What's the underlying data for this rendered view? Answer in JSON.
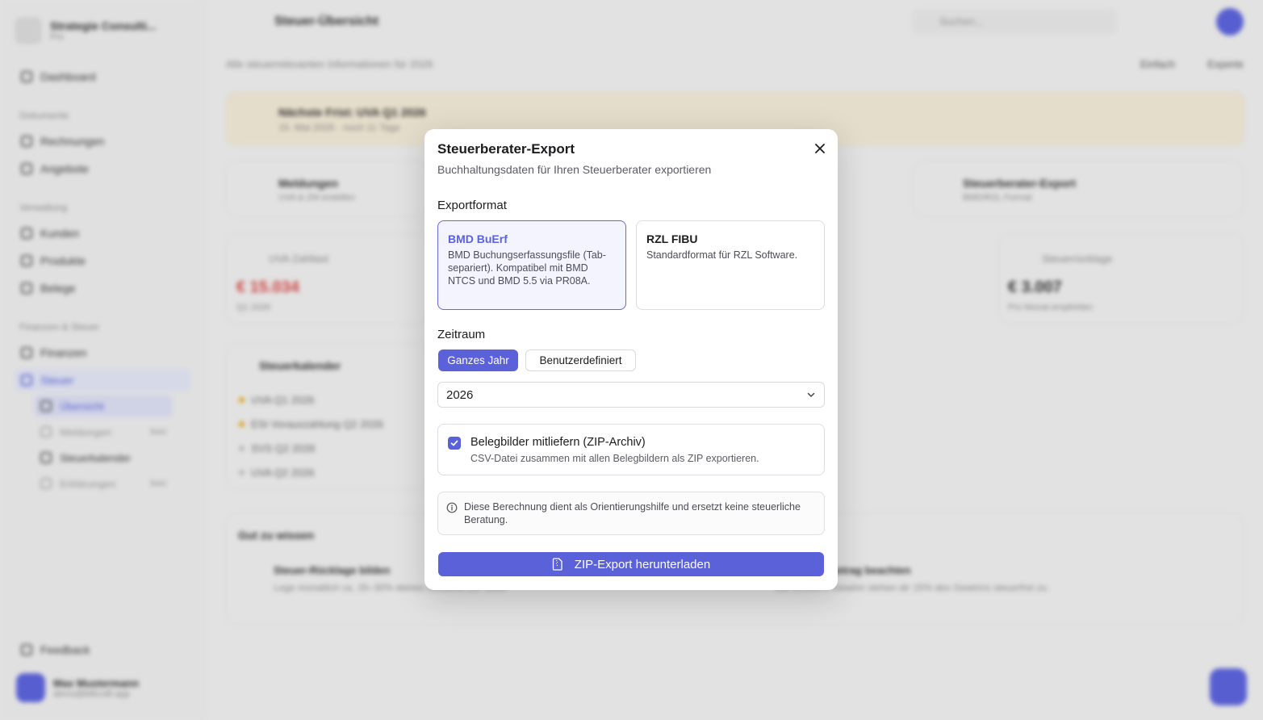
{
  "background": {
    "workspace": {
      "name": "Strategie Consulti...",
      "plan": "Pro"
    },
    "sidebar": {
      "dashboard": "Dashboard",
      "group_documents": "Dokumente",
      "invoices": "Rechnungen",
      "offers": "Angebote",
      "group_admin": "Verwaltung",
      "customers": "Kunden",
      "products": "Produkte",
      "receipts": "Belege",
      "group_finance": "Finanzen & Steuer",
      "finances": "Finanzen",
      "taxes": "Steuer",
      "overview": "Übersicht",
      "reports": "Meldungen",
      "reports_badge": "Bald",
      "tax_calendar": "Steuerkalender",
      "annual": "Erklärungen",
      "annual_badge": "Bald",
      "feedback": "Feedback"
    },
    "user": {
      "name": "Max Mustermann",
      "email": "demo@billcraft.app"
    },
    "topbar": {
      "title": "Steuer-Übersicht",
      "search_placeholder": "Suchen..."
    },
    "subline": "Alle steuerrelevanten Informationen für 2026",
    "actions": {
      "simple": "Einfach",
      "expert": "Experte"
    },
    "deadline": {
      "title": "Nächste Frist: UVA Q1 2026",
      "subtitle": "15. Mai 2026 · noch 11 Tage"
    },
    "quick": {
      "reports_title": "Meldungen",
      "reports_sub": "UVA & ZM erstellen",
      "export_title": "Steuerberater-Export",
      "export_sub": "BMD/RZL Format"
    },
    "stats": {
      "uva_label": "UVA Zahllast",
      "uva_amount": "€ 15.034",
      "uva_period": "Q1 2026",
      "reserve_label": "Steuerrücklage",
      "reserve_amount": "€ 3.007",
      "reserve_note": "Pro Monat empfohlen"
    },
    "calendar": {
      "title": "Steuerkalender",
      "items": [
        "UVA Q1 2026",
        "ESt Vorauszahlung Q2 2026",
        "SVS Q2 2026",
        "UVA Q2 2026"
      ]
    },
    "tips": {
      "title": "Gut zu wissen",
      "tip1_title": "Steuer-Rücklage bilden",
      "tip1_text": "Lege monatlich ca. 20–30% deines Gewinns zur Seite.",
      "tip2_title": "Gewinnfreibetrag beachten",
      "tip2_text": "Bis 33.000 € Gewinn stehen dir 15% des Gewinns steuerfrei zu."
    }
  },
  "modal": {
    "title": "Steuerberater-Export",
    "subtitle": "Buchhaltungsdaten für Ihren Steuerberater exportieren",
    "format_label": "Exportformat",
    "formats": [
      {
        "title": "BMD BuErf",
        "desc": "BMD Buchungserfassungsfile (Tab-separiert). Kompatibel mit BMD NTCS und BMD 5.5 via PR08A.",
        "selected": true
      },
      {
        "title": "RZL FIBU",
        "desc": "Standardformat für RZL Software.",
        "selected": false
      }
    ],
    "period_label": "Zeitraum",
    "period_options": [
      {
        "label": "Ganzes Jahr",
        "active": true
      },
      {
        "label": "Benutzerdefiniert",
        "active": false
      }
    ],
    "year_select": {
      "value": "2026"
    },
    "include_images": {
      "checked": true,
      "title": "Belegbilder mitliefern (ZIP-Archiv)",
      "desc": "CSV-Datei zusammen mit allen Belegbildern als ZIP exportieren."
    },
    "info_text": "Diese Berechnung dient als Orientierungshilfe und ersetzt keine steuerliche Beratung.",
    "submit_label": "ZIP-Export herunterladen"
  },
  "colors": {
    "accent": "#5b62d9",
    "accent_light": "#f3f4fd",
    "warning_bg": "#efe7d4",
    "negative": "#d64545"
  },
  "icons": {
    "close": "close-icon",
    "chevron": "chevron-down-icon",
    "check": "check-icon",
    "info": "info-icon",
    "file_zip": "file-zip-icon"
  }
}
